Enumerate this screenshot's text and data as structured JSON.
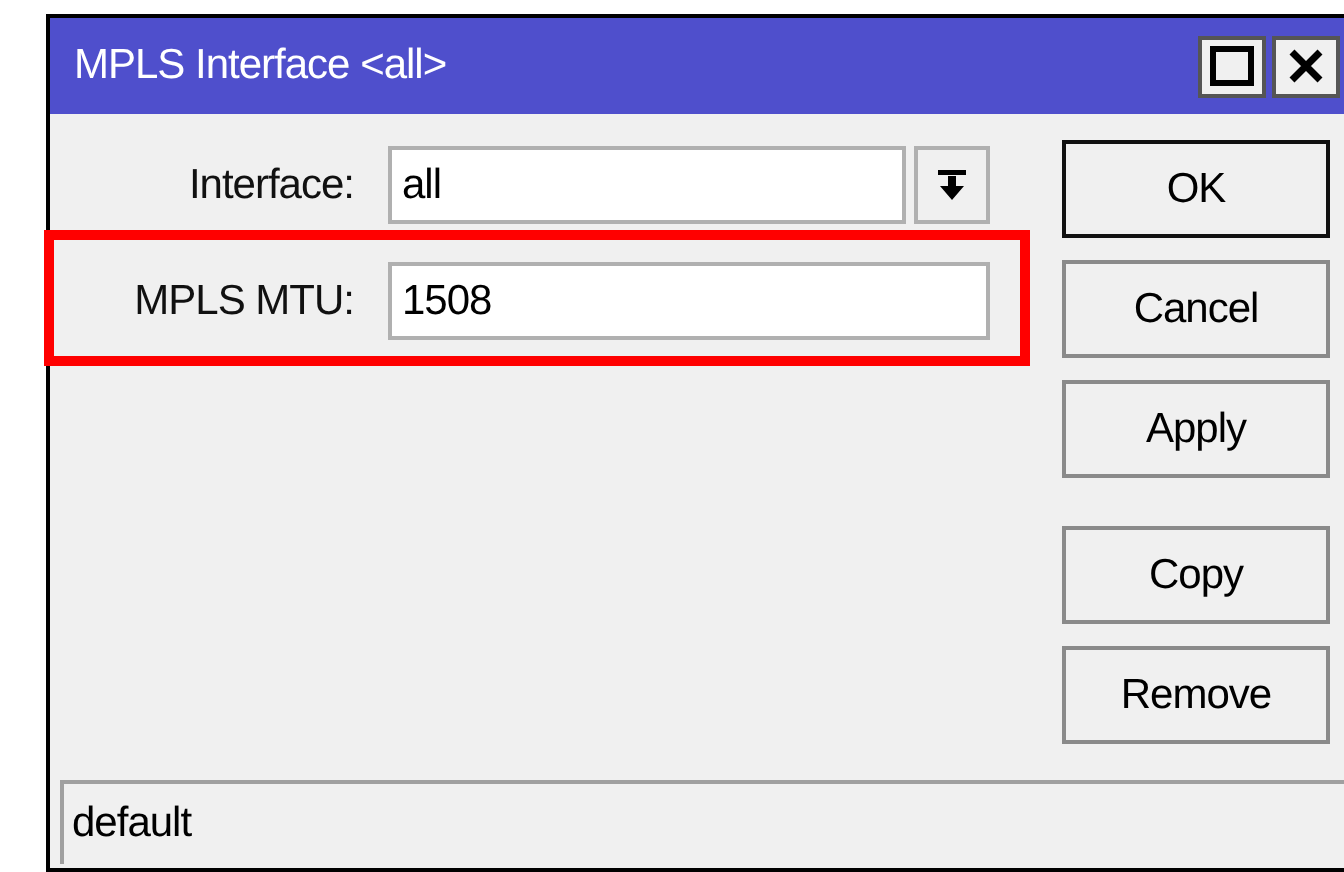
{
  "window": {
    "title": "MPLS Interface <all>",
    "controls": [
      {
        "kind": "maximize"
      },
      {
        "kind": "close"
      }
    ]
  },
  "fields": [
    {
      "label": "Interface:",
      "value": "all",
      "kind": "dropdown",
      "highlighted": false
    },
    {
      "label": "MPLS MTU:",
      "value": "1508",
      "kind": "text",
      "highlighted": true
    }
  ],
  "buttons": [
    {
      "label": "OK",
      "default": true
    },
    {
      "label": "Cancel",
      "default": false
    },
    {
      "label": "Apply",
      "default": false
    },
    {
      "label": "Copy",
      "default": false
    },
    {
      "label": "Remove",
      "default": false
    }
  ],
  "status_bar": "default"
}
